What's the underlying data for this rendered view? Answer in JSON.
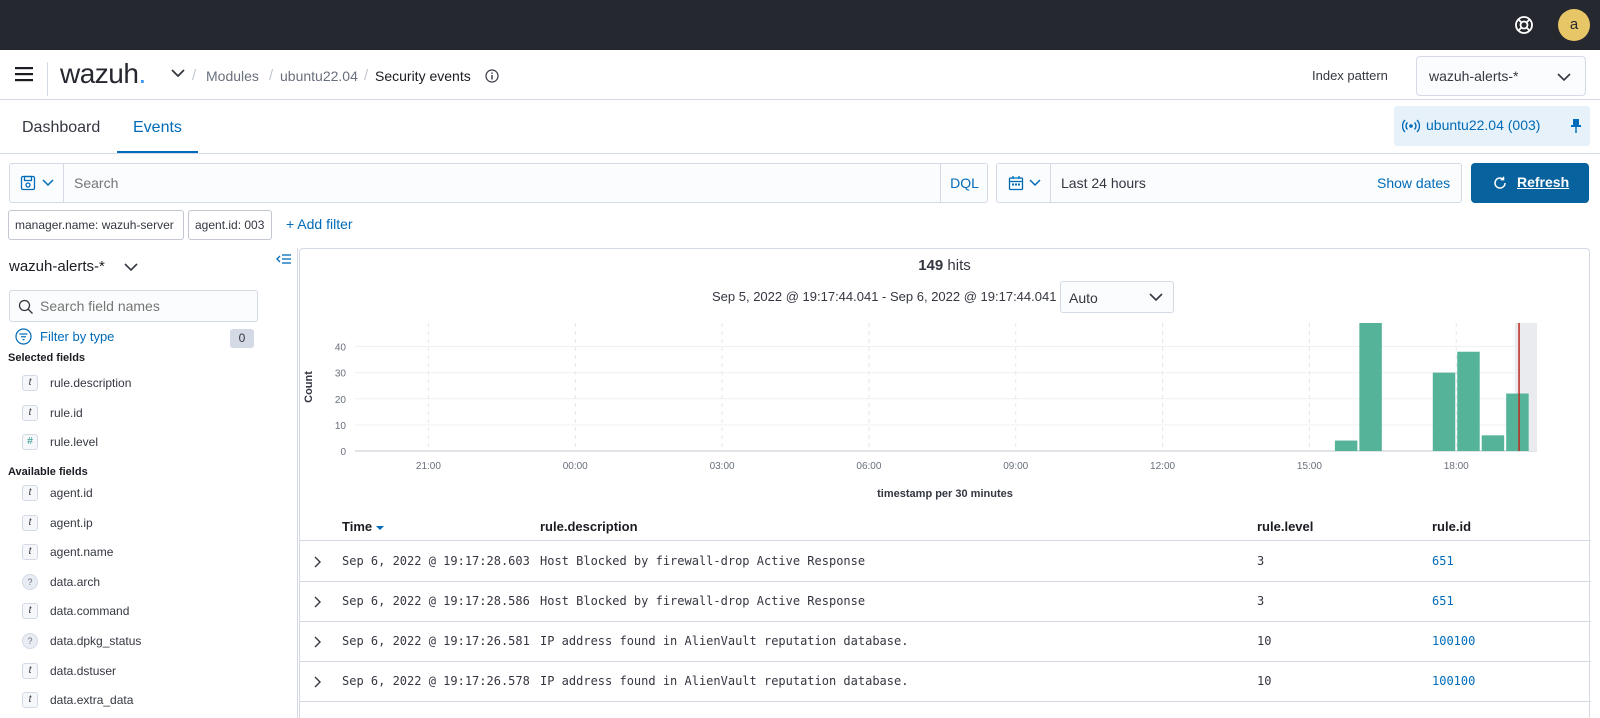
{
  "topbar": {
    "avatar_letter": "a"
  },
  "header": {
    "logo": "wazuh",
    "breadcrumbs": [
      "Modules",
      "ubuntu22.04",
      "Security events"
    ],
    "index_pattern_label": "Index pattern",
    "index_pattern_value": "wazuh-alerts-*"
  },
  "tabs": [
    "Dashboard",
    "Events"
  ],
  "active_tab": "Events",
  "agent_pill": "ubuntu22.04 (003)",
  "search": {
    "placeholder": "Search",
    "language": "DQL"
  },
  "date": {
    "range": "Last 24 hours",
    "show_dates": "Show dates",
    "refresh": "Refresh"
  },
  "filters": [
    "manager.name: wazuh-server",
    "agent.id: 003"
  ],
  "add_filter": "+ Add filter",
  "sidebar": {
    "index": "wazuh-alerts-*",
    "search_placeholder": "Search field names",
    "filter_by_type": "Filter by type",
    "filter_count": "0",
    "selected_title": "Selected fields",
    "selected_fields": [
      {
        "type": "t",
        "name": "rule.description"
      },
      {
        "type": "t",
        "name": "rule.id"
      },
      {
        "type": "#",
        "name": "rule.level"
      }
    ],
    "available_title": "Available fields",
    "available_fields": [
      {
        "type": "t",
        "name": "agent.id"
      },
      {
        "type": "t",
        "name": "agent.ip"
      },
      {
        "type": "t",
        "name": "agent.name"
      },
      {
        "type": "?",
        "name": "data.arch"
      },
      {
        "type": "t",
        "name": "data.command"
      },
      {
        "type": "?",
        "name": "data.dpkg_status"
      },
      {
        "type": "t",
        "name": "data.dstuser"
      },
      {
        "type": "t",
        "name": "data.extra_data"
      }
    ]
  },
  "histogram": {
    "hits_count": "149",
    "hits_label": "hits",
    "time_range": "Sep 5, 2022 @ 19:17:44.041 - Sep 6, 2022 @ 19:17:44.041",
    "interval": "Auto"
  },
  "chart_data": {
    "type": "bar",
    "ylabel": "Count",
    "xlabel": "timestamp per 30 minutes",
    "x_ticks": [
      "21:00",
      "00:00",
      "03:00",
      "06:00",
      "09:00",
      "12:00",
      "15:00",
      "18:00"
    ],
    "y_ticks": [
      0,
      10,
      20,
      30,
      40
    ],
    "ylim": [
      0,
      49
    ],
    "bars": [
      {
        "start": "15:30",
        "value": 4
      },
      {
        "start": "16:00",
        "value": 49
      },
      {
        "start": "17:30",
        "value": 30
      },
      {
        "start": "18:00",
        "value": 38
      },
      {
        "start": "18:30",
        "value": 6
      },
      {
        "start": "19:00",
        "value": 22
      }
    ],
    "bar_color": "#54b399",
    "now_marker": "19:17"
  },
  "table": {
    "columns": [
      "Time",
      "rule.description",
      "rule.level",
      "rule.id"
    ],
    "rows": [
      [
        "Sep 6, 2022 @ 19:17:28.603",
        "Host Blocked by firewall-drop Active Response",
        "3",
        "651"
      ],
      [
        "Sep 6, 2022 @ 19:17:28.586",
        "Host Blocked by firewall-drop Active Response",
        "3",
        "651"
      ],
      [
        "Sep 6, 2022 @ 19:17:26.581",
        "IP address found in AlienVault reputation database.",
        "10",
        "100100"
      ],
      [
        "Sep 6, 2022 @ 19:17:26.578",
        "IP address found in AlienVault reputation database.",
        "10",
        "100100"
      ]
    ]
  }
}
